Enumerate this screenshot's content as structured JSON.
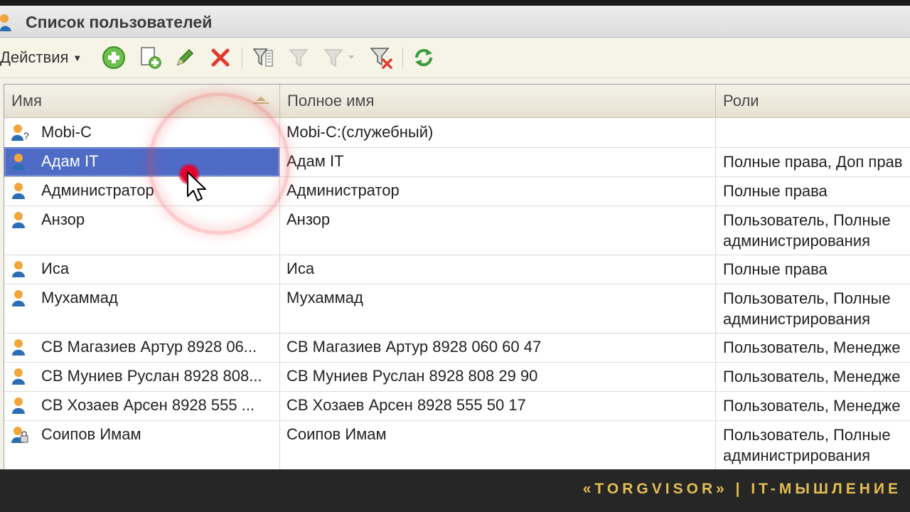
{
  "window": {
    "title": "Список пользователей"
  },
  "toolbar": {
    "actions_label": "Действия",
    "buttons": [
      "add-icon",
      "copy-icon",
      "edit-icon",
      "delete-icon",
      "filter-settings-icon",
      "filter-by-value-icon",
      "filter-history-icon",
      "filter-clear-icon",
      "refresh-icon"
    ]
  },
  "table": {
    "columns": [
      "Имя",
      "Полное имя",
      "Роли"
    ],
    "sort_column": "Имя",
    "selected_row": 1,
    "rows": [
      {
        "icon": "user-unknown-icon",
        "name": "Mobi-C",
        "full_name": "Mobi-C:(служебный)",
        "roles": ""
      },
      {
        "icon": "user-icon",
        "name": "Адам IT",
        "full_name": "Адам IT",
        "roles": "Полные права, Доп прав"
      },
      {
        "icon": "user-icon",
        "name": "Администратор",
        "full_name": "Администратор",
        "roles": "Полные права"
      },
      {
        "icon": "user-icon",
        "name": "Анзор",
        "full_name": "Анзор",
        "roles": "Пользователь, Полные администрирования"
      },
      {
        "icon": "user-icon",
        "name": "Иса",
        "full_name": "Иса",
        "roles": "Полные права"
      },
      {
        "icon": "user-icon",
        "name": "Мухаммад",
        "full_name": "Мухаммад",
        "roles": "Пользователь, Полные администрирования"
      },
      {
        "icon": "user-icon",
        "name": "СВ Магазиев Артур 8928 06...",
        "full_name": "СВ Магазиев Артур 8928 060 60 47",
        "roles": "Пользователь, Менедже"
      },
      {
        "icon": "user-icon",
        "name": "СВ Муниев Руслан 8928 808...",
        "full_name": "СВ Муниев Руслан 8928 808 29 90",
        "roles": "Пользователь, Менедже"
      },
      {
        "icon": "user-icon",
        "name": "СВ Хозаев Арсен 8928 555 ...",
        "full_name": "СВ Хозаев Арсен 8928 555 50 17",
        "roles": "Пользователь, Менедже"
      },
      {
        "icon": "user-locked-icon",
        "name": "Соипов Имам",
        "full_name": "Соипов Имам",
        "roles": "Пользователь, Полные администрирования"
      }
    ]
  },
  "footer": {
    "brand": "«TORGVISOR» | IT-МЫШЛЕНИЕ"
  },
  "colors": {
    "selection": "#4e6bc6",
    "brand": "#e3bd52",
    "click_marker": "#e4002b"
  }
}
